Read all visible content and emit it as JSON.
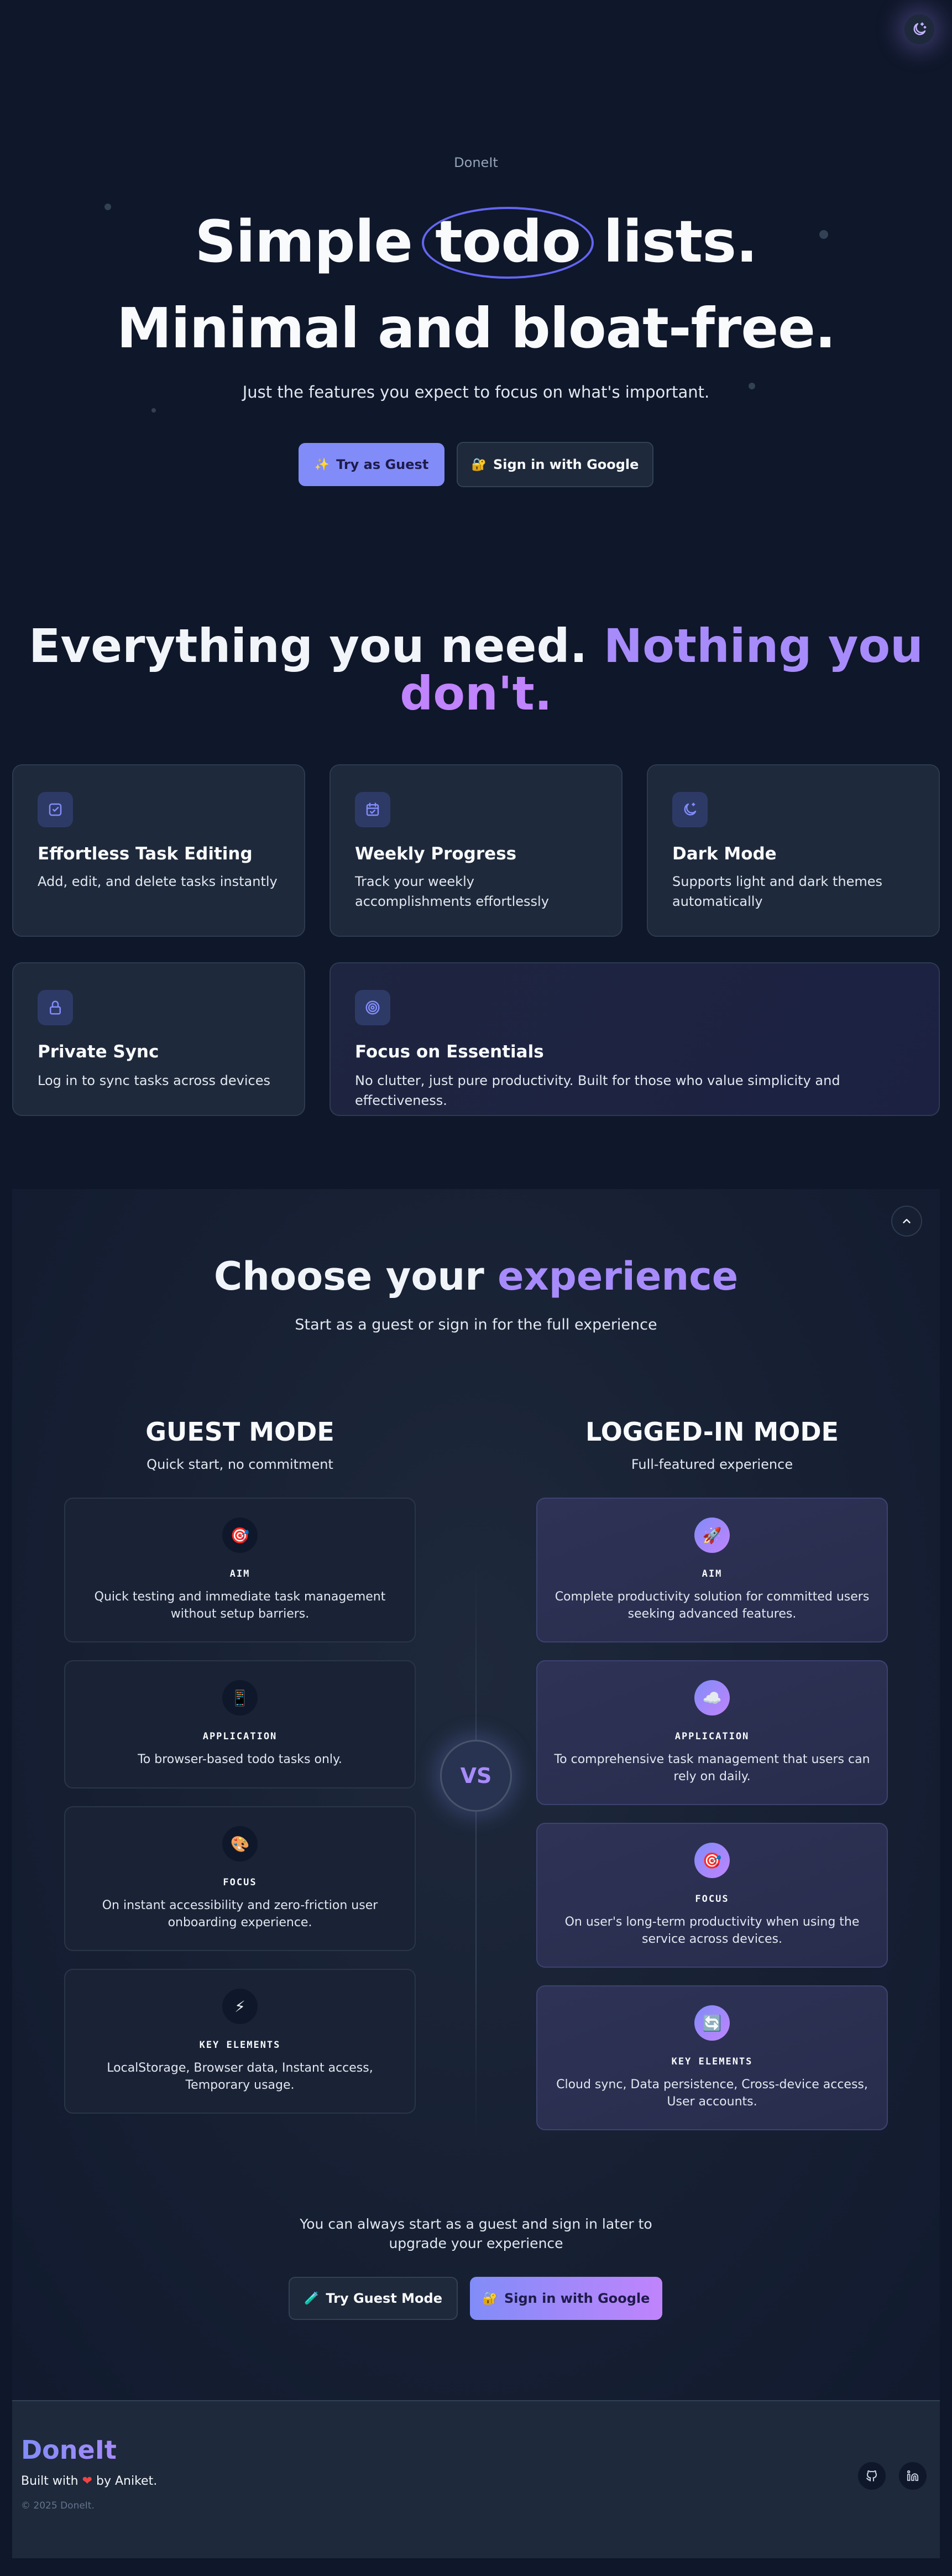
{
  "brand": "DoneIt",
  "hero": {
    "title_before": "Simple",
    "title_highlight": "todo",
    "title_after": "lists.",
    "title_line2": "Minimal and bloat-free.",
    "subtitle": "Just the features you expect to focus on what's important.",
    "guest_button": "Try as Guest",
    "google_button": "Sign in with Google",
    "guest_icon": "✨",
    "google_icon": "🔐"
  },
  "features": {
    "title_plain": "Everything you need.",
    "title_accent_1": "Nothing you",
    "title_accent_2": "don't.",
    "cards": [
      {
        "icon": "checkbox-icon",
        "title": "Effortless Task Editing",
        "text": "Add, edit, and delete tasks instantly"
      },
      {
        "icon": "calendar-icon",
        "title": "Weekly Progress",
        "text": "Track your weekly accomplishments effortlessly"
      },
      {
        "icon": "moon-icon",
        "title": "Dark Mode",
        "text": "Supports light and dark themes automatically"
      },
      {
        "icon": "lock-icon",
        "title": "Private Sync",
        "text": "Log in to sync tasks across devices"
      },
      {
        "icon": "target-icon",
        "title": "Focus on Essentials",
        "text": "No clutter, just pure productivity. Built for those who value simplicity and effectiveness."
      }
    ]
  },
  "experience": {
    "title_plain": "Choose your",
    "title_accent": "experience",
    "subtitle": "Start as a guest or sign in for the full experience",
    "vs": "VS",
    "guest": {
      "title": "GUEST MODE",
      "subtitle": "Quick start, no commitment",
      "items": [
        {
          "icon": "🎯",
          "label": "AIM",
          "text": "Quick testing and immediate task management without setup barriers."
        },
        {
          "icon": "📱",
          "label": "APPLICATION",
          "text": "To browser-based todo tasks only."
        },
        {
          "icon": "🎨",
          "label": "FOCUS",
          "text": "On instant accessibility and zero-friction user onboarding experience."
        },
        {
          "icon": "⚡",
          "label": "KEY ELEMENTS",
          "text": "LocalStorage, Browser data, Instant access, Temporary usage."
        }
      ]
    },
    "logged": {
      "title": "LOGGED-IN MODE",
      "subtitle": "Full-featured experience",
      "items": [
        {
          "icon": "🚀",
          "label": "AIM",
          "text": "Complete productivity solution for committed users seeking advanced features."
        },
        {
          "icon": "☁️",
          "label": "APPLICATION",
          "text": "To comprehensive task management that users can rely on daily."
        },
        {
          "icon": "🎯",
          "label": "FOCUS",
          "text": "On user's long-term productivity when using the service across devices."
        },
        {
          "icon": "🔄",
          "label": "KEY ELEMENTS",
          "text": "Cloud sync, Data persistence, Cross-device access, User accounts."
        }
      ]
    },
    "later_text": "You can always start as a guest and sign in later to upgrade your experience",
    "guest_button": "Try Guest Mode",
    "google_button": "Sign in with Google",
    "guest_button_icon": "🧪",
    "google_button_icon": "🔐"
  },
  "footer": {
    "brand": "DoneIt",
    "built_before": "Built with",
    "heart": "❤",
    "built_after": "by Aniket.",
    "copyright": "© 2025 DoneIt.",
    "socials": [
      "github-icon",
      "linkedin-icon"
    ]
  },
  "colors": {
    "background": "#0f172a",
    "card": "#1e293b",
    "accent": "#818cf8",
    "accent_purple": "#a78bfa",
    "accent_pink": "#c084fc"
  }
}
